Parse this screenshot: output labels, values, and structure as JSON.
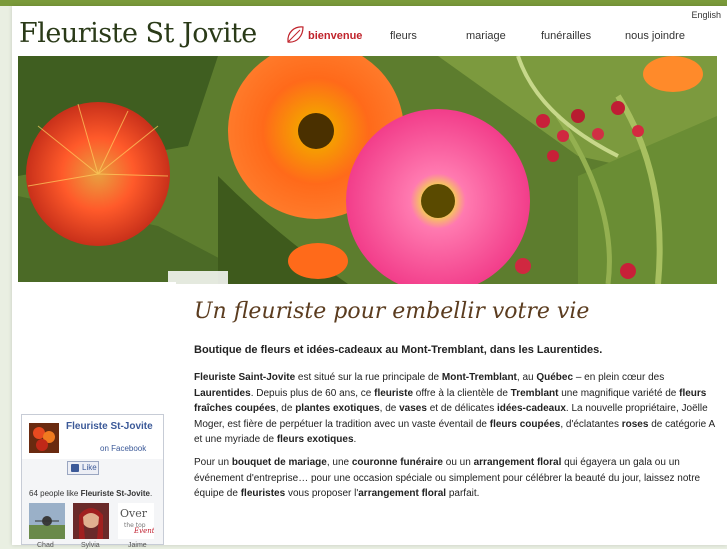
{
  "header": {
    "logo": "Fleuriste St Jovite",
    "lang_link": "English"
  },
  "nav": {
    "items": [
      "bienvenue",
      "fleurs",
      "mariage",
      "funérailles",
      "nous joindre"
    ]
  },
  "tagline": "Un fleuriste pour embellir votre vie",
  "content": {
    "heading": "Boutique de fleurs et idées-cadeaux au Mont-Tremblant, dans les Laurentides.",
    "p1": [
      {
        "t": "Fleuriste Saint-Jovite",
        "b": true
      },
      {
        "t": " est situé sur la rue principale de ",
        "b": false
      },
      {
        "t": "Mont-Tremblant",
        "b": true
      },
      {
        "t": ", au ",
        "b": false
      },
      {
        "t": "Québec",
        "b": true
      },
      {
        "t": " – en plein cœur des ",
        "b": false
      },
      {
        "t": "Laurentides",
        "b": true
      },
      {
        "t": ". Depuis plus de 60 ans, ce ",
        "b": false
      },
      {
        "t": "fleuriste",
        "b": true
      },
      {
        "t": " offre à la clientèle de ",
        "b": false
      },
      {
        "t": "Tremblant",
        "b": true
      },
      {
        "t": " une magnifique variété de ",
        "b": false
      },
      {
        "t": "fleurs fraîches coupées",
        "b": true
      },
      {
        "t": ", de ",
        "b": false
      },
      {
        "t": "plantes exotiques",
        "b": true
      },
      {
        "t": ", de ",
        "b": false
      },
      {
        "t": "vases",
        "b": true
      },
      {
        "t": " et de délicates ",
        "b": false
      },
      {
        "t": "idées-cadeaux",
        "b": true
      },
      {
        "t": ". La nouvelle propriétaire, Joëlle Moger, est fière de perpétuer la tradition avec un vaste éventail de ",
        "b": false
      },
      {
        "t": "fleurs coupées",
        "b": true
      },
      {
        "t": ", d'éclatantes ",
        "b": false
      },
      {
        "t": "roses",
        "b": true
      },
      {
        "t": " de catégorie A et une myriade de ",
        "b": false
      },
      {
        "t": "fleurs exotiques",
        "b": true
      },
      {
        "t": ".",
        "b": false
      }
    ],
    "p2": [
      {
        "t": "Pour un ",
        "b": false
      },
      {
        "t": "bouquet de mariage",
        "b": true
      },
      {
        "t": ", une ",
        "b": false
      },
      {
        "t": "couronne funéraire",
        "b": true
      },
      {
        "t": " ou un ",
        "b": false
      },
      {
        "t": "arrangement floral",
        "b": true
      },
      {
        "t": " qui égayera un gala ou un événement d'entreprise… pour une occasion spéciale ou simplement pour célébrer la beauté du jour, laissez notre équipe de ",
        "b": false
      },
      {
        "t": "fleuristes",
        "b": true
      },
      {
        "t": " vous proposer l'",
        "b": false
      },
      {
        "t": "arrangement floral",
        "b": true
      },
      {
        "t": " parfait.",
        "b": false
      }
    ]
  },
  "facebook": {
    "page_name": "Fleuriste St-Jovite",
    "on_facebook": "on Facebook",
    "like_label": "Like",
    "count_prefix": "64 people like ",
    "count_page": "Fleuriste St-Jovite",
    "count_suffix": ".",
    "fans": [
      "Chad",
      "Sylvia",
      "Jaime"
    ],
    "fan3_logo": "Over the top"
  },
  "colors": {
    "accent": "#c0232b",
    "brand_green": "#7a9a3a",
    "facebook_blue": "#3b5998"
  }
}
